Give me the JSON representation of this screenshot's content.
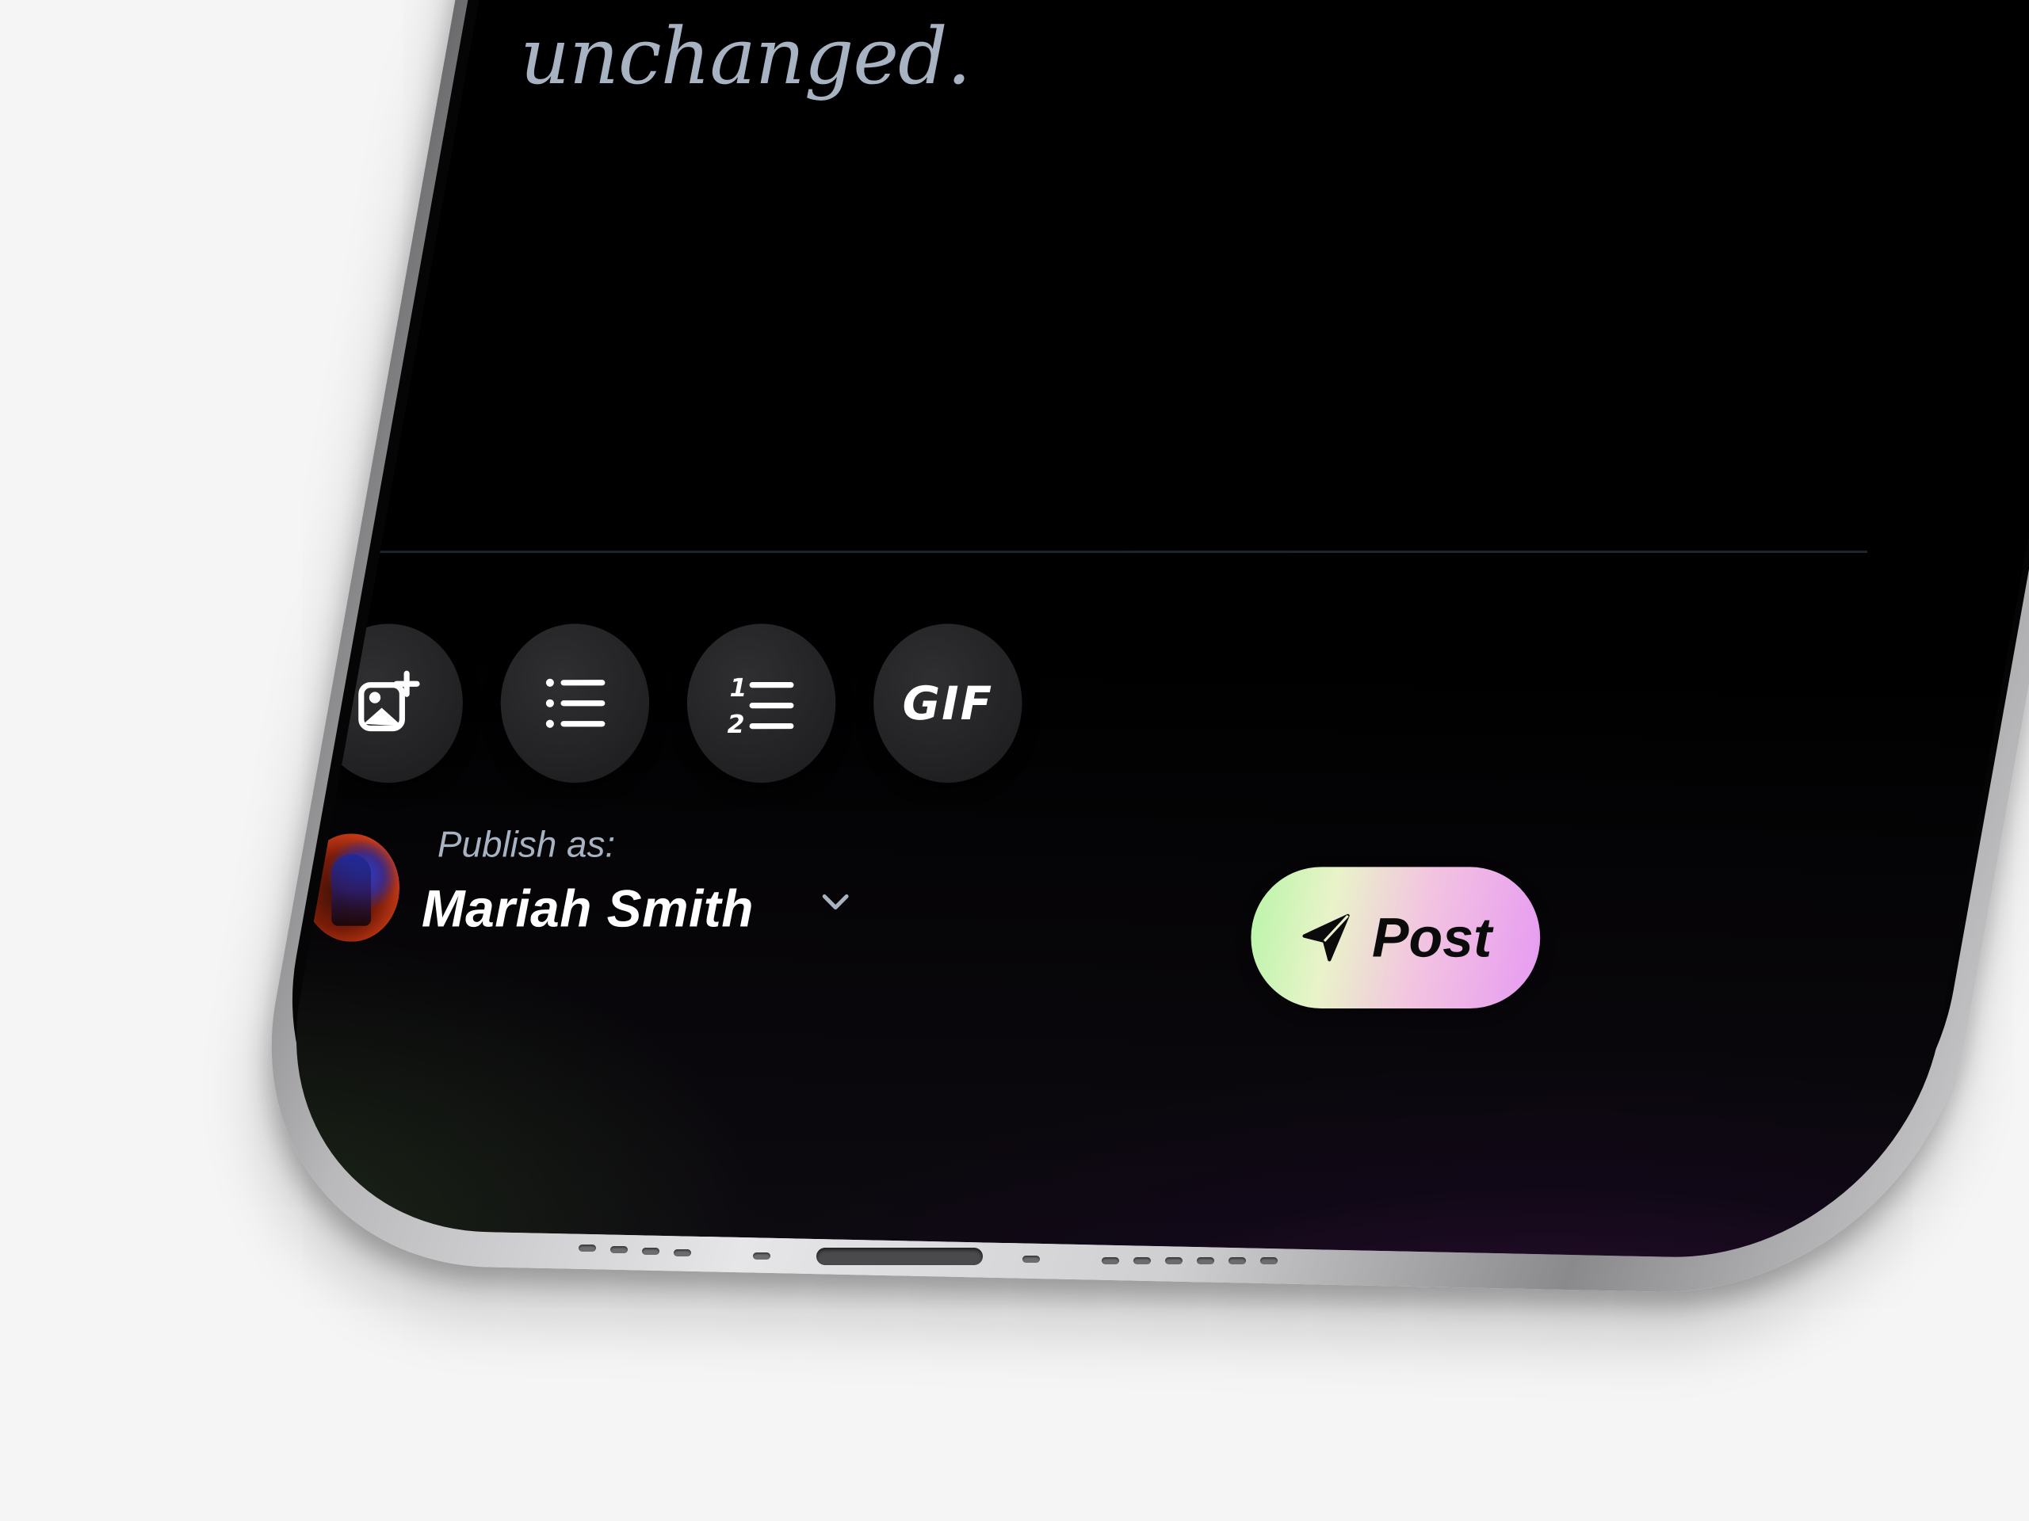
{
  "editor": {
    "body_text": "unchanged."
  },
  "toolbar": {
    "buttons": [
      {
        "name": "add-image",
        "icon": "image-plus-icon"
      },
      {
        "name": "bulleted-list",
        "icon": "bullet-list-icon"
      },
      {
        "name": "numbered-list",
        "icon": "numbered-list-icon"
      },
      {
        "name": "gif",
        "label": "GIF",
        "icon": "gif-icon"
      }
    ]
  },
  "publish": {
    "label": "Publish as:",
    "author_name": "Mariah Smith",
    "dropdown_icon": "chevron-down-icon"
  },
  "post_button": {
    "label": "Post",
    "icon": "send-icon"
  },
  "colors": {
    "background": "#f5f5f5",
    "screen": "#000000",
    "muted_text": "#a7b3c2",
    "post_gradient_start": "#b8f5a8",
    "post_gradient_end": "#e79af2"
  }
}
